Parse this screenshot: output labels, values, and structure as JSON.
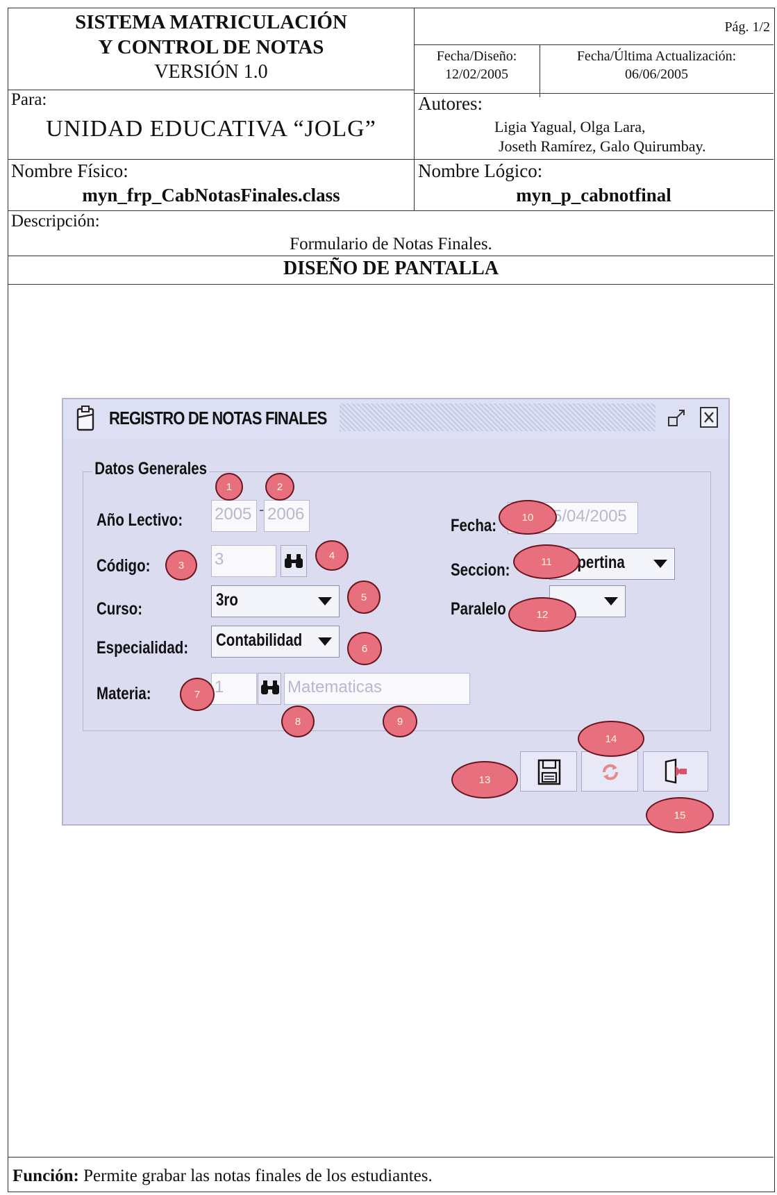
{
  "header": {
    "system_line1": "SISTEMA MATRICULACIÓN",
    "system_line2": "Y CONTROL DE NOTAS",
    "version": "VERSIÓN 1.0",
    "page": "Pág. 1/2",
    "design_date_label": "Fecha/Diseño:",
    "design_date": "12/02/2005",
    "update_date_label": "Fecha/Última Actualización:",
    "update_date": "06/06/2005",
    "para_label": "Para:",
    "institution": "UNIDAD EDUCATIVA “JOLG”",
    "authors_label": "Autores:",
    "authors_line1": "Ligia Yagual, Olga Lara,",
    "authors_line2": "Joseth Ramírez, Galo Quirumbay.",
    "physical_name_label": "Nombre Físico:",
    "physical_name": "myn_frp_CabNotasFinales.class",
    "logical_name_label": "Nombre Lógico:",
    "logical_name": "myn_p_cabnotfinal",
    "description_label": "Descripción:",
    "description": "Formulario de Notas Finales.",
    "section_title": "DISEÑO DE PANTALLA"
  },
  "window": {
    "title": "REGISTRO DE NOTAS FINALES",
    "group_title": "Datos Generales",
    "ano_lectivo_label": "Año Lectivo:",
    "ano_inicio": "2005",
    "ano_separator": "-",
    "ano_fin": "2006",
    "codigo_label": "Código:",
    "codigo_value": "3",
    "curso_label": "Curso:",
    "curso_value": "3ro",
    "especialidad_label": "Especialidad:",
    "especialidad_value": "Contabilidad",
    "materia_label": "Materia:",
    "materia_codigo": "1",
    "materia_nombre": "Matematicas",
    "fecha_label": "Fecha:",
    "fecha_value": "5/04/2005",
    "seccion_label": "Seccion:",
    "seccion_value": "spertina",
    "paralelo_label": "Paralelo",
    "paralelo_value": ""
  },
  "callouts": [
    "1",
    "2",
    "3",
    "4",
    "5",
    "6",
    "7",
    "8",
    "9",
    "10",
    "11",
    "12",
    "13",
    "14",
    "15"
  ],
  "footer": {
    "funcion_label": "Función:",
    "funcion_text": "Permite grabar las notas finales de los estudiantes."
  },
  "colors": {
    "window_bg": "#dcdcf0",
    "callout_fill": "#e8707e",
    "callout_border": "#6a1620"
  }
}
